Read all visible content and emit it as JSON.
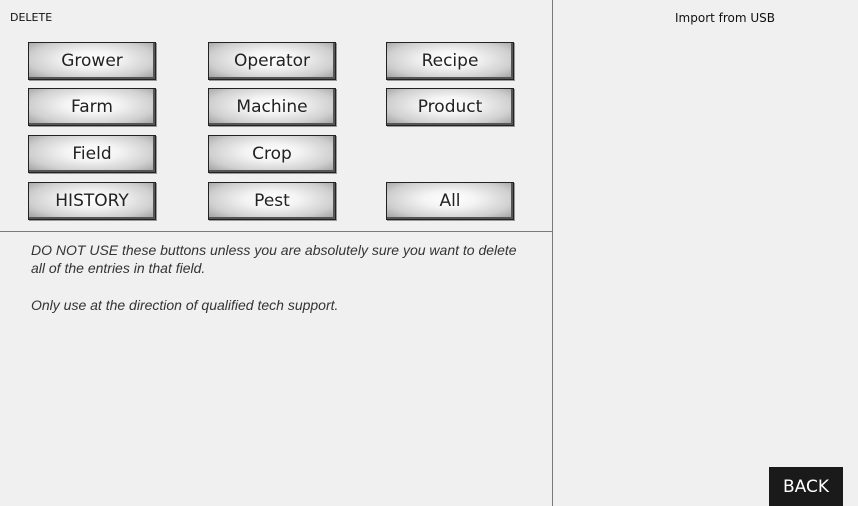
{
  "delete_panel": {
    "title": "DELETE",
    "buttons": [
      "Grower",
      "Operator",
      "Recipe",
      "Farm",
      "Machine",
      "Product",
      "Field",
      "Crop",
      "HISTORY",
      "Pest",
      "All"
    ],
    "warning": "DO NOT USE these buttons unless you are absolutely sure you want to delete all of the entries in that field.",
    "note": "Only use at the direction of qualified tech support."
  },
  "usb_panel": {
    "title": "Import from USB",
    "back_label": "BACK"
  },
  "colors": {
    "background": "#f0f0f0",
    "back_button": "#1a1a1a",
    "back_text": "#ffffff"
  }
}
